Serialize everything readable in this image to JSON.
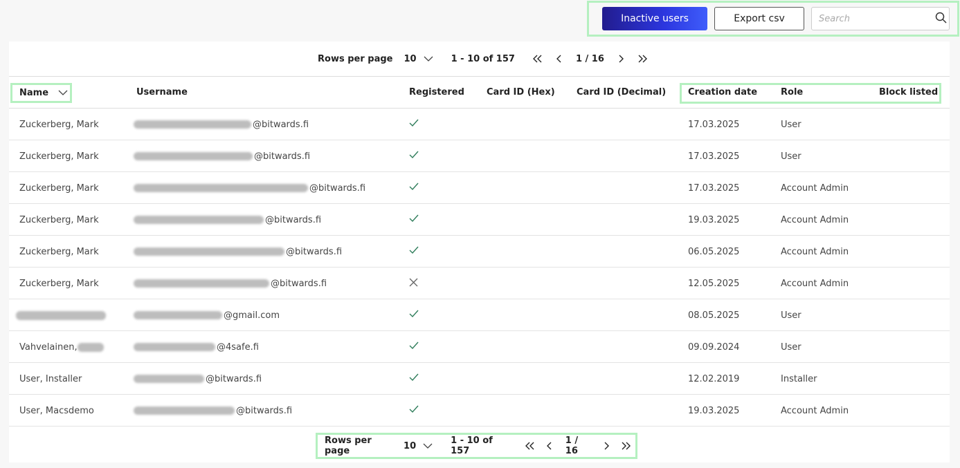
{
  "toolbar": {
    "inactive_label": "Inactive users",
    "export_label": "Export csv",
    "search_placeholder": "Search"
  },
  "pagination": {
    "rows_per_page_label": "Rows per page",
    "rows_per_page_value": "10",
    "range": "1 - 10 of 157",
    "page": "1 / 16"
  },
  "table": {
    "columns": [
      "Name",
      "Username",
      "Registered",
      "Card ID (Hex)",
      "Card ID (Decimal)",
      "Creation date",
      "Role",
      "Block listed"
    ],
    "rows": [
      {
        "name": "Zuckerberg, Mark",
        "email_suffix": "@bitwards.fi",
        "registered": true,
        "card_hex": "",
        "card_dec": "",
        "created": "17.03.2025",
        "role": "User"
      },
      {
        "name": "Zuckerberg, Mark",
        "email_suffix": "@bitwards.fi",
        "registered": true,
        "card_hex": "",
        "card_dec": "",
        "created": "17.03.2025",
        "role": "User"
      },
      {
        "name": "Zuckerberg, Mark",
        "email_suffix": "@bitwards.fi",
        "registered": true,
        "card_hex": "",
        "card_dec": "",
        "created": "17.03.2025",
        "role": "Account Admin"
      },
      {
        "name": "Zuckerberg, Mark",
        "email_suffix": "@bitwards.fi",
        "registered": true,
        "card_hex": "",
        "card_dec": "",
        "created": "19.03.2025",
        "role": "Account Admin"
      },
      {
        "name": "Zuckerberg, Mark",
        "email_suffix": "@bitwards.fi",
        "registered": true,
        "card_hex": "",
        "card_dec": "",
        "created": "06.05.2025",
        "role": "Account Admin"
      },
      {
        "name": "Zuckerberg, Mark",
        "email_suffix": "@bitwards.fi",
        "registered": false,
        "card_hex": "",
        "card_dec": "",
        "created": "12.05.2025",
        "role": "Account Admin"
      },
      {
        "name": "",
        "email_suffix": "@gmail.com",
        "registered": true,
        "card_hex": "",
        "card_dec": "",
        "created": "08.05.2025",
        "role": "User"
      },
      {
        "name": "Vahvelainen,",
        "email_suffix": "@4safe.fi",
        "registered": true,
        "card_hex": "",
        "card_dec": "",
        "created": "09.09.2024",
        "role": "User"
      },
      {
        "name": "User, Installer",
        "email_suffix": "@bitwards.fi",
        "registered": true,
        "card_hex": "",
        "card_dec": "",
        "created": "12.02.2019",
        "role": "Installer"
      },
      {
        "name": "User, Macsdemo",
        "email_suffix": "@bitwards.fi",
        "registered": true,
        "card_hex": "",
        "card_dec": "",
        "created": "19.03.2025",
        "role": "Account Admin"
      }
    ]
  }
}
